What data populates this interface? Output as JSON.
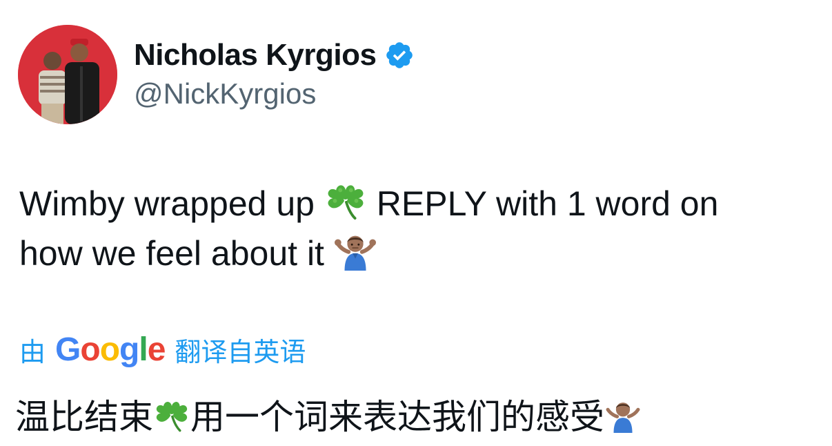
{
  "author": {
    "display_name": "Nicholas Kyrgios",
    "handle": "@NickKyrgios",
    "verified_icon": "verified-badge-icon",
    "avatar_background": "#d8303a"
  },
  "tweet": {
    "line1_part1": "Wimby wrapped up",
    "line1_emoji": "shamrock-emoji",
    "line1_part2": "REPLY with 1 word on",
    "line2_part1": "how we feel about it",
    "line2_emoji": "person-shrugging-emoji"
  },
  "translation": {
    "prefix": "由",
    "provider": "Google",
    "suffix": "翻译自英语",
    "text_part1": "温比结束",
    "text_emoji": "shamrock-emoji",
    "text_part2": "用一个词来表达我们的感受",
    "text_emoji2": "person-shrugging-emoji"
  },
  "colors": {
    "link_blue": "#1d9bf0",
    "handle_gray": "#536471",
    "text": "#0f1419",
    "google_blue": "#4285f4",
    "google_red": "#ea4335",
    "google_yellow": "#fbbc05",
    "google_green": "#34a853"
  }
}
